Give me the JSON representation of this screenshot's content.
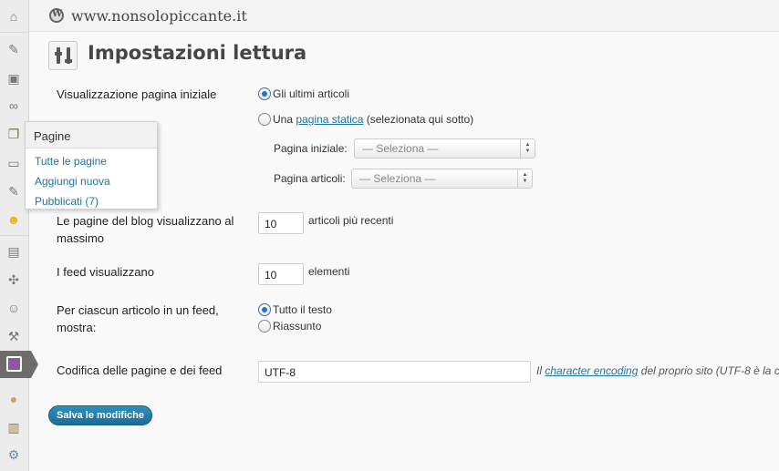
{
  "site": {
    "name": "www.nonsolopiccante.it"
  },
  "page": {
    "title": "Impostazioni lettura"
  },
  "sidebar": {
    "icons": [
      "dashboard-icon",
      "posts-pin-icon",
      "media-icon",
      "links-icon",
      "pages-icon",
      "comments-icon",
      "pin-icon",
      "smiley-icon",
      "appearance-icon",
      "plugins-icon",
      "users-icon",
      "tools-icon",
      "settings-icon",
      "egg-icon",
      "chart-icon",
      "gear-icon"
    ]
  },
  "flyout": {
    "title": "Pagine",
    "items": [
      "Tutte le pagine",
      "Aggiungi nuova",
      "Pubblicati (7)"
    ]
  },
  "front_page": {
    "label": "Visualizzazione pagina iniziale",
    "option_latest": "Gli ultimi articoli",
    "option_static_prefix": "Una",
    "option_static_link": "pagina statica",
    "option_static_suffix": "(selezionata qui sotto)",
    "selected": "latest",
    "homepage_label": "Pagina iniziale:",
    "homepage_value": "— Seleziona —",
    "postspage_label": "Pagina articoli:",
    "postspage_value": "— Seleziona —"
  },
  "posts_per_page": {
    "label": "Le pagine del blog visualizzano al massimo",
    "value": "10",
    "suffix": "articoli più recenti"
  },
  "feed_items": {
    "label": "I feed visualizzano",
    "value": "10",
    "suffix": "elementi"
  },
  "feed_content": {
    "label": "Per ciascun articolo in un feed, mostra:",
    "option_full": "Tutto il testo",
    "option_summary": "Riassunto",
    "selected": "full"
  },
  "encoding": {
    "label": "Codifica delle pagine e dei feed",
    "value": "UTF-8",
    "desc_prefix": "Il",
    "desc_link": "character encoding",
    "desc_suffix": "del proprio sito (UTF-8 è la c"
  },
  "save_button": "Salva le modifiche"
}
